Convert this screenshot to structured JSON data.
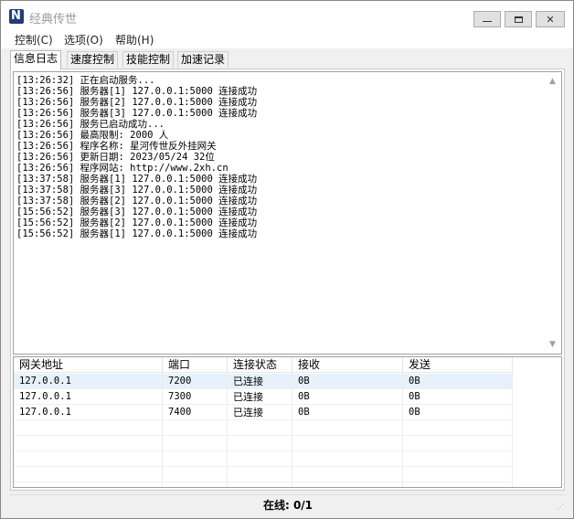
{
  "window": {
    "title": "经典传世"
  },
  "menu": [
    "控制(C)",
    "选项(O)",
    "帮助(H)"
  ],
  "tabs": [
    "信息日志",
    "速度控制",
    "技能控制",
    "加速记录"
  ],
  "log": [
    "[13:26:32] 正在启动服务...",
    "[13:26:56] 服务器[1] 127.0.0.1:5000 连接成功",
    "[13:26:56] 服务器[2] 127.0.0.1:5000 连接成功",
    "[13:26:56] 服务器[3] 127.0.0.1:5000 连接成功",
    "[13:26:56] 服务已启动成功...",
    "[13:26:56] 最高限制: 2000 人",
    "[13:26:56] 程序名称: 星河传世反外挂网关",
    "[13:26:56] 更新日期: 2023/05/24 32位",
    "[13:26:56] 程序网站: http://www.2xh.cn",
    "[13:37:58] 服务器[1] 127.0.0.1:5000 连接成功",
    "[13:37:58] 服务器[3] 127.0.0.1:5000 连接成功",
    "[13:37:58] 服务器[2] 127.0.0.1:5000 连接成功",
    "[15:56:52] 服务器[3] 127.0.0.1:5000 连接成功",
    "[15:56:52] 服务器[2] 127.0.0.1:5000 连接成功",
    "[15:56:52] 服务器[1] 127.0.0.1:5000 连接成功"
  ],
  "table": {
    "headers": [
      "网关地址",
      "端口",
      "连接状态",
      "接收",
      "发送"
    ],
    "rows": [
      [
        "127.0.0.1",
        "7200",
        "已连接",
        "0B",
        "0B"
      ],
      [
        "127.0.0.1",
        "7300",
        "已连接",
        "0B",
        "0B"
      ],
      [
        "127.0.0.1",
        "7400",
        "已连接",
        "0B",
        "0B"
      ]
    ]
  },
  "status": {
    "online": "在线: 0/1"
  }
}
